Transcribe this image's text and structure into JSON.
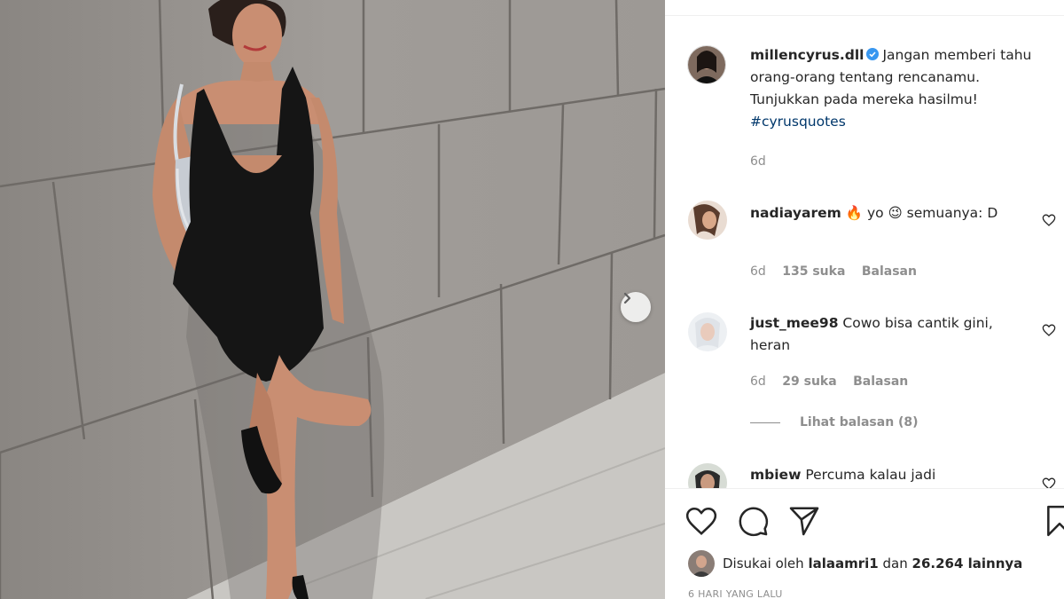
{
  "post": {
    "author": "millencyrus.dll",
    "caption_text": "Jangan memberi tahu orang-orang tentang rencanamu. Tunjukkan pada mereka hasilmu!",
    "hashtag": "#cyrusquotes",
    "caption_age": "6d"
  },
  "comments": [
    {
      "user": "nadiayarem",
      "text_a": "yo",
      "text_b": "semuanya: D",
      "age": "6d",
      "likes": "135 suka",
      "reply": "Balasan"
    },
    {
      "user": "just_mee98",
      "text": "Cowo bisa cantik gini, heran",
      "age": "6d",
      "likes": "29 suka",
      "reply": "Balasan"
    },
    {
      "user": "mbiew",
      "text": "Percuma kalau jadi"
    }
  ],
  "view_replies": "Lihat balasan (8)",
  "likes_summary": {
    "prefix": "Disukai oleh",
    "user": "lalaamri1",
    "middle": "dan",
    "count": "26.264 lainnya"
  },
  "time_ago": "6 HARI YANG LALU",
  "icons": [
    "heart-icon",
    "comment-icon",
    "share-icon",
    "bookmark-icon",
    "chevron-right-icon",
    "verified-badge-icon",
    "fire-emoji-icon",
    "wink-emoji-icon"
  ],
  "colors": {
    "link": "#00376b",
    "muted": "#8e8e8e",
    "verified": "#3897f0",
    "text": "#262626"
  }
}
